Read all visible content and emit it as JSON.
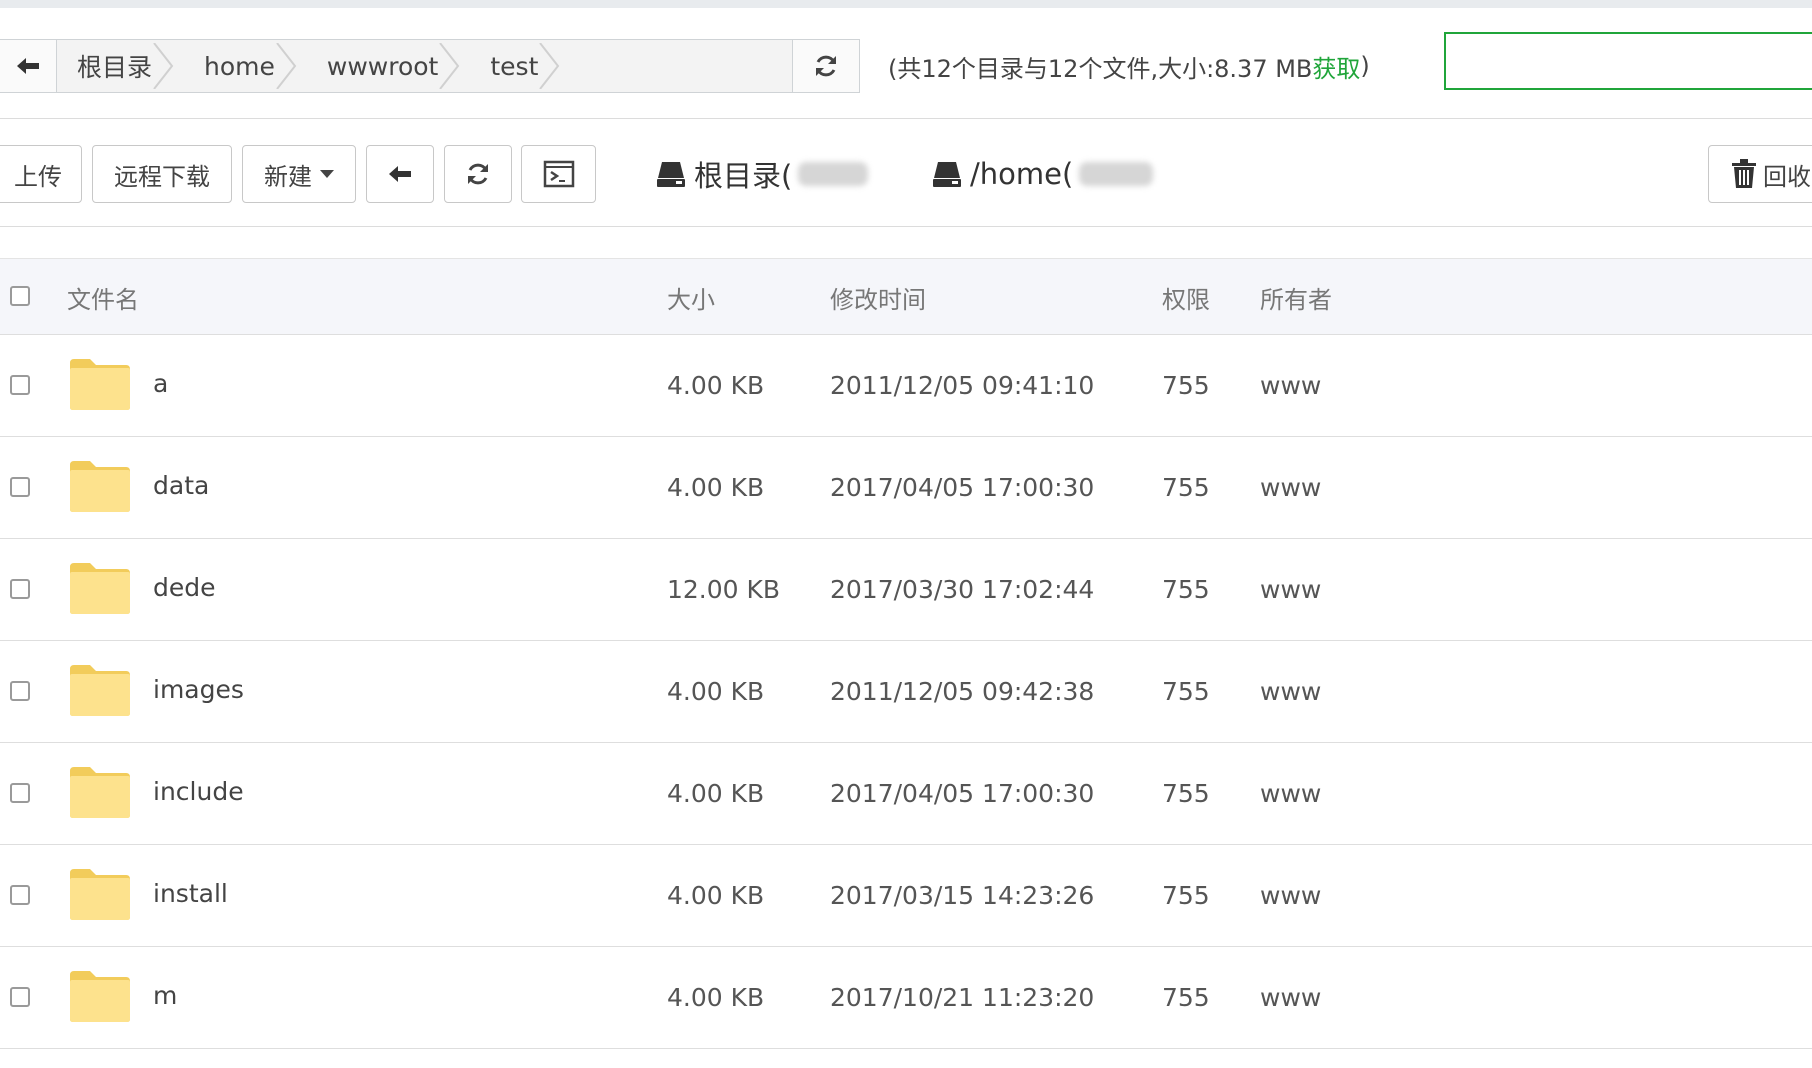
{
  "pathbar": {
    "crumbs": [
      {
        "label": "根目录"
      },
      {
        "label": "home"
      },
      {
        "label": "wwwroot"
      },
      {
        "label": "test"
      }
    ]
  },
  "summary": {
    "prefix": "(共12个目录与12个文件,大小:8.37 MB ",
    "link": "获取",
    "suffix": ")"
  },
  "search": {
    "value": "",
    "placeholder": ""
  },
  "toolbar": {
    "upload": "上传",
    "remote_download": "远程下载",
    "new": "新建",
    "recycle": "回收"
  },
  "disks": [
    {
      "label": "根目录("
    },
    {
      "label": "/home("
    }
  ],
  "table": {
    "headers": {
      "name": "文件名",
      "size": "大小",
      "mtime": "修改时间",
      "perm": "权限",
      "owner": "所有者"
    },
    "rows": [
      {
        "name": "a",
        "size": "4.00 KB",
        "mtime": "2011/12/05 09:41:10",
        "perm": "755",
        "owner": "www"
      },
      {
        "name": "data",
        "size": "4.00 KB",
        "mtime": "2017/04/05 17:00:30",
        "perm": "755",
        "owner": "www"
      },
      {
        "name": "dede",
        "size": "12.00 KB",
        "mtime": "2017/03/30 17:02:44",
        "perm": "755",
        "owner": "www"
      },
      {
        "name": "images",
        "size": "4.00 KB",
        "mtime": "2011/12/05 09:42:38",
        "perm": "755",
        "owner": "www"
      },
      {
        "name": "include",
        "size": "4.00 KB",
        "mtime": "2017/04/05 17:00:30",
        "perm": "755",
        "owner": "www"
      },
      {
        "name": "install",
        "size": "4.00 KB",
        "mtime": "2017/03/15 14:23:26",
        "perm": "755",
        "owner": "www"
      },
      {
        "name": "m",
        "size": "4.00 KB",
        "mtime": "2017/10/21 11:23:20",
        "perm": "755",
        "owner": "www"
      }
    ]
  },
  "colors": {
    "accent": "#20a53a",
    "folder": "#fde28d",
    "folder_dark": "#f2cc5b"
  },
  "icons": {
    "back": "arrow-left-icon",
    "refresh": "refresh-icon",
    "terminal": "terminal-icon",
    "disk": "hdd-icon",
    "trash": "trash-icon",
    "folder": "folder-icon",
    "caret": "caret-down-icon"
  }
}
